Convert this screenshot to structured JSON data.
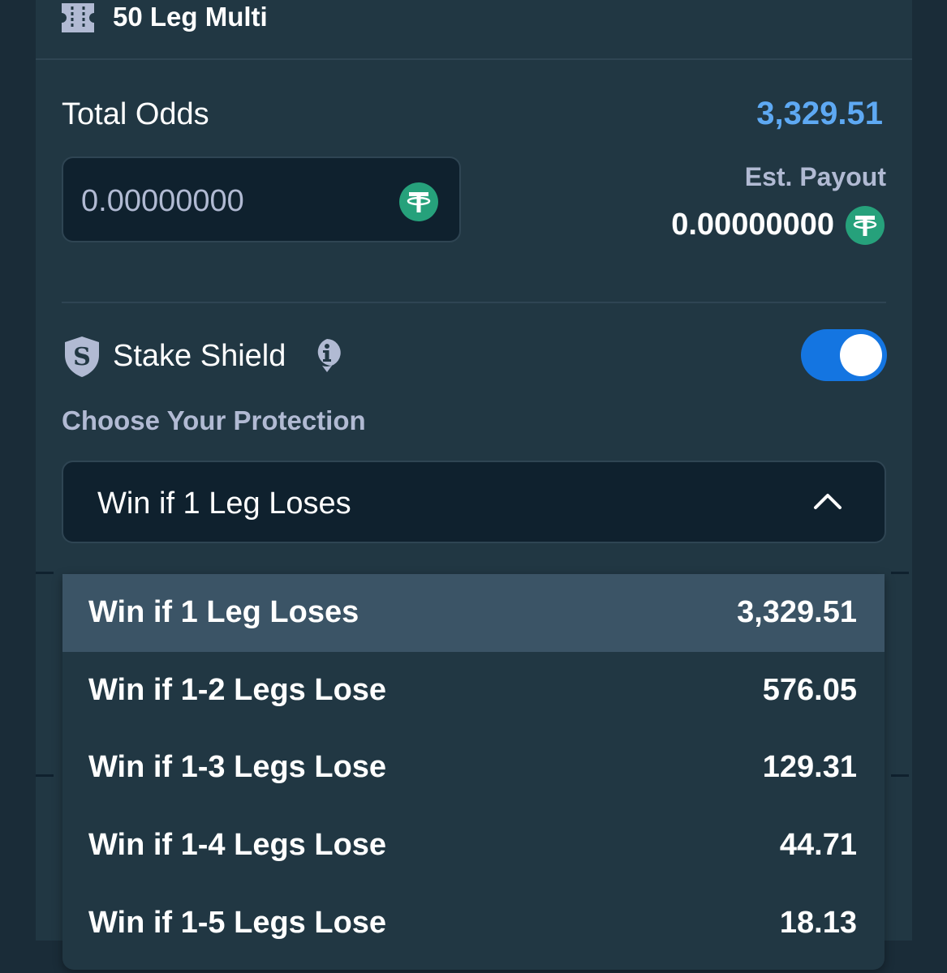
{
  "header": {
    "title": "50 Leg Multi",
    "icon": "ticket-icon"
  },
  "odds": {
    "label": "Total Odds",
    "value": "3,329.51",
    "value_color": "#5ea9f3"
  },
  "stake": {
    "value": "0.00000000",
    "currency_icon": "usdt-icon",
    "currency_color": "#26a17b"
  },
  "payout": {
    "label": "Est. Payout",
    "value": "0.00000000"
  },
  "shield": {
    "label": "Stake Shield",
    "enabled": true,
    "toggle_color": "#1475e1"
  },
  "protection": {
    "label": "Choose Your Protection",
    "selected": "Win if 1 Leg Loses",
    "options": [
      {
        "label": "Win if 1 Leg Loses",
        "odds": "3,329.51",
        "selected": true
      },
      {
        "label": "Win if 1-2 Legs Lose",
        "odds": "576.05",
        "selected": false
      },
      {
        "label": "Win if 1-3 Legs Lose",
        "odds": "129.31",
        "selected": false
      },
      {
        "label": "Win if 1-4 Legs Lose",
        "odds": "44.71",
        "selected": false
      },
      {
        "label": "Win if 1-5 Legs Lose",
        "odds": "18.13",
        "selected": false
      }
    ]
  }
}
